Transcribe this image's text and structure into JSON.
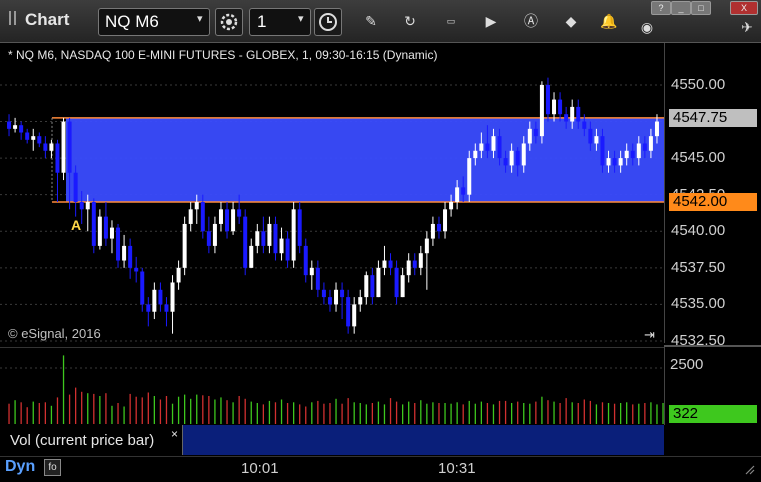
{
  "toolbar": {
    "title": "Chart",
    "symbol": "NQ M6",
    "interval": "1",
    "tools": [
      "settings-icon",
      "clock-icon",
      "pencil-icon",
      "refresh-icon",
      "get-icon",
      "play-icon",
      "alert-icon",
      "tag-icon",
      "bell-icon",
      "globe-icon",
      "bird-icon"
    ],
    "window_buttons": [
      "?",
      "_",
      "□",
      "X"
    ]
  },
  "chart": {
    "symbol_line": "* NQ M6, NASDAQ 100 E-MINI FUTURES - GLOBEX, 1, 09:30-16:15 (Dynamic)",
    "copyright": "© eSignal, 2016",
    "marker": "A",
    "price_ticks": [
      "4550.00",
      "4547.50",
      "4545.00",
      "4542.50",
      "4540.00",
      "4537.50",
      "4535.00",
      "4532.50"
    ],
    "price_tag_high": "4547.75",
    "price_tag_low": "4542.00",
    "volume_ticks": [
      "2500"
    ],
    "volume_tag": "322",
    "volume_tab_label": "Vol (current price bar)",
    "volume_tab_close": "×",
    "time_labels": [
      "10:01",
      "10:31"
    ],
    "dyn_label": "Dyn",
    "colors": {
      "up": "#ffffff",
      "down": "#1a1aff",
      "band": "#3a4cff",
      "band_line": "#ff8a3a",
      "tag_low": "#ff8a1a",
      "tag_high": "#bfbfbf",
      "vol_tag": "#3ec81e"
    }
  },
  "chart_data": {
    "type": "candlestick",
    "y_range": [
      4532.5,
      4551.5
    ],
    "band": {
      "low": 4542.0,
      "high": 4547.75
    },
    "candles": [
      [
        4547.5,
        4547.0,
        4548.0,
        4546.5
      ],
      [
        4547.0,
        4547.25,
        4547.75,
        4546.75
      ],
      [
        4547.25,
        4546.75,
        4547.5,
        4546.25
      ],
      [
        4546.75,
        4546.25,
        4547.0,
        4546.0
      ],
      [
        4546.25,
        4546.5,
        4547.0,
        4545.5
      ],
      [
        4546.5,
        4546.0,
        4546.75,
        4545.75
      ],
      [
        4546.0,
        4545.5,
        4546.5,
        4545.0
      ],
      [
        4545.5,
        4546.0,
        4546.25,
        4545.0
      ],
      [
        4546.0,
        4544.0,
        4546.25,
        4542.0
      ],
      [
        4544.0,
        4547.5,
        4547.75,
        4543.5
      ],
      [
        4547.5,
        4544.0,
        4547.75,
        4541.5
      ],
      [
        4544.0,
        4542.0,
        4544.5,
        4541.0
      ],
      [
        4542.0,
        4541.5,
        4542.75,
        4540.5
      ],
      [
        4541.5,
        4542.0,
        4542.5,
        4540.0
      ],
      [
        4542.0,
        4539.0,
        4542.25,
        4538.5
      ],
      [
        4539.0,
        4541.0,
        4541.5,
        4538.75
      ],
      [
        4541.0,
        4539.5,
        4542.0,
        4539.0
      ],
      [
        4539.5,
        4540.25,
        4540.75,
        4538.5
      ],
      [
        4540.25,
        4538.0,
        4540.5,
        4537.5
      ],
      [
        4538.0,
        4539.0,
        4539.75,
        4537.5
      ],
      [
        4539.0,
        4537.5,
        4539.5,
        4536.75
      ],
      [
        4537.5,
        4537.25,
        4538.25,
        4536.5
      ],
      [
        4537.25,
        4535.0,
        4537.5,
        4534.5
      ],
      [
        4535.0,
        4534.5,
        4535.5,
        4533.5
      ],
      [
        4534.5,
        4536.0,
        4536.5,
        4534.0
      ],
      [
        4536.0,
        4535.0,
        4536.5,
        4534.5
      ],
      [
        4535.0,
        4534.5,
        4535.5,
        4533.5
      ],
      [
        4534.5,
        4536.5,
        4537.0,
        4533.0
      ],
      [
        4536.5,
        4537.5,
        4538.0,
        4536.0
      ],
      [
        4537.5,
        4540.5,
        4541.0,
        4537.0
      ],
      [
        4540.5,
        4541.5,
        4542.0,
        4540.0
      ],
      [
        4541.5,
        4542.0,
        4542.5,
        4540.5
      ],
      [
        4542.0,
        4540.0,
        4542.5,
        4539.5
      ],
      [
        4540.0,
        4539.0,
        4541.0,
        4538.5
      ],
      [
        4539.0,
        4540.5,
        4541.0,
        4538.5
      ],
      [
        4540.5,
        4541.5,
        4542.0,
        4540.0
      ],
      [
        4541.5,
        4540.0,
        4542.0,
        4539.5
      ],
      [
        4540.0,
        4541.5,
        4542.0,
        4539.75
      ],
      [
        4541.5,
        4541.0,
        4542.5,
        4540.5
      ],
      [
        4541.0,
        4537.5,
        4541.5,
        4537.0
      ],
      [
        4537.5,
        4539.0,
        4539.5,
        4537.5
      ],
      [
        4539.0,
        4540.0,
        4540.5,
        4538.5
      ],
      [
        4540.0,
        4539.0,
        4541.0,
        4538.5
      ],
      [
        4539.0,
        4540.5,
        4541.0,
        4538.5
      ],
      [
        4540.5,
        4538.5,
        4541.0,
        4538.0
      ],
      [
        4538.5,
        4539.5,
        4540.25,
        4538.0
      ],
      [
        4539.5,
        4538.0,
        4540.0,
        4537.5
      ],
      [
        4538.0,
        4541.5,
        4542.0,
        4537.5
      ],
      [
        4541.5,
        4539.0,
        4542.0,
        4538.5
      ],
      [
        4539.0,
        4537.0,
        4539.5,
        4536.5
      ],
      [
        4537.0,
        4537.5,
        4538.0,
        4536.0
      ],
      [
        4537.5,
        4536.0,
        4538.0,
        4535.5
      ],
      [
        4536.0,
        4535.5,
        4536.5,
        4535.0
      ],
      [
        4535.5,
        4535.0,
        4536.0,
        4534.5
      ],
      [
        4535.0,
        4536.0,
        4536.5,
        4534.5
      ],
      [
        4536.0,
        4535.5,
        4536.5,
        4534.0
      ],
      [
        4535.5,
        4533.5,
        4536.0,
        4533.0
      ],
      [
        4533.5,
        4535.0,
        4535.5,
        4533.0
      ],
      [
        4535.0,
        4535.5,
        4536.0,
        4534.5
      ],
      [
        4535.5,
        4537.0,
        4537.25,
        4535.0
      ],
      [
        4537.0,
        4535.5,
        4537.5,
        4535.0
      ],
      [
        4535.5,
        4537.5,
        4538.0,
        4535.5
      ],
      [
        4537.5,
        4538.0,
        4539.0,
        4537.0
      ],
      [
        4538.0,
        4537.5,
        4538.5,
        4537.0
      ],
      [
        4537.5,
        4535.5,
        4538.0,
        4535.0
      ],
      [
        4535.5,
        4537.0,
        4537.5,
        4535.5
      ],
      [
        4537.0,
        4538.0,
        4538.5,
        4536.5
      ],
      [
        4538.0,
        4537.5,
        4538.5,
        4537.0
      ],
      [
        4537.5,
        4538.5,
        4539.0,
        4537.0
      ],
      [
        4538.5,
        4539.5,
        4540.0,
        4536.0
      ],
      [
        4539.5,
        4540.5,
        4541.0,
        4539.0
      ],
      [
        4540.5,
        4540.0,
        4541.0,
        4539.5
      ],
      [
        4540.0,
        4541.5,
        4542.0,
        4539.5
      ],
      [
        4541.5,
        4542.0,
        4542.5,
        4541.0
      ],
      [
        4542.0,
        4543.0,
        4543.5,
        4541.5
      ],
      [
        4543.0,
        4542.5,
        4543.75,
        4542.0
      ],
      [
        4542.5,
        4545.0,
        4545.5,
        4542.0
      ],
      [
        4545.0,
        4545.5,
        4546.0,
        4544.5
      ],
      [
        4545.5,
        4546.0,
        4546.75,
        4545.0
      ],
      [
        4546.0,
        4545.5,
        4547.25,
        4545.0
      ],
      [
        4545.5,
        4546.5,
        4547.0,
        4545.0
      ],
      [
        4546.5,
        4545.0,
        4547.0,
        4544.5
      ],
      [
        4545.0,
        4544.5,
        4545.5,
        4544.0
      ],
      [
        4544.5,
        4545.5,
        4546.0,
        4544.0
      ],
      [
        4545.5,
        4544.5,
        4545.75,
        4543.75
      ],
      [
        4544.5,
        4546.0,
        4546.5,
        4544.0
      ],
      [
        4546.0,
        4547.0,
        4547.5,
        4545.5
      ],
      [
        4547.0,
        4546.5,
        4547.5,
        4546.0
      ],
      [
        4546.5,
        4550.0,
        4550.25,
        4546.0
      ],
      [
        4550.0,
        4548.0,
        4550.5,
        4547.5
      ],
      [
        4548.0,
        4549.0,
        4549.5,
        4547.5
      ],
      [
        4549.0,
        4548.0,
        4549.5,
        4547.5
      ],
      [
        4548.0,
        4547.5,
        4548.5,
        4547.0
      ],
      [
        4547.5,
        4548.5,
        4549.0,
        4547.0
      ],
      [
        4548.5,
        4547.5,
        4549.0,
        4547.0
      ],
      [
        4547.5,
        4547.0,
        4548.0,
        4546.5
      ],
      [
        4547.0,
        4546.0,
        4547.5,
        4545.5
      ],
      [
        4546.0,
        4546.5,
        4547.0,
        4545.5
      ],
      [
        4546.5,
        4544.5,
        4547.0,
        4544.0
      ],
      [
        4544.5,
        4545.0,
        4545.5,
        4544.0
      ],
      [
        4545.0,
        4544.5,
        4545.5,
        4544.0
      ],
      [
        4544.5,
        4545.0,
        4545.5,
        4544.0
      ],
      [
        4545.0,
        4545.5,
        4546.0,
        4544.5
      ],
      [
        4545.5,
        4545.0,
        4546.0,
        4544.5
      ],
      [
        4545.0,
        4546.0,
        4546.5,
        4544.5
      ],
      [
        4546.0,
        4545.5,
        4546.5,
        4545.0
      ],
      [
        4545.5,
        4546.5,
        4547.0,
        4545.0
      ],
      [
        4546.5,
        4547.5,
        4548.0,
        4546.0
      ]
    ],
    "volumes": [
      290,
      340,
      310,
      240,
      320,
      300,
      310,
      260,
      380,
      980,
      420,
      520,
      460,
      440,
      430,
      400,
      440,
      260,
      300,
      250,
      430,
      390,
      380,
      450,
      400,
      350,
      400,
      290,
      390,
      420,
      360,
      420,
      410,
      400,
      350,
      380,
      340,
      310,
      400,
      360,
      320,
      300,
      280,
      330,
      310,
      350,
      300,
      310,
      280,
      250,
      310,
      330,
      290,
      300,
      360,
      290,
      370,
      310,
      300,
      280,
      300,
      320,
      280,
      370,
      320,
      280,
      320,
      300,
      340,
      290,
      310,
      300,
      300,
      290,
      310,
      280,
      330,
      290,
      320,
      300,
      280,
      330,
      330,
      300,
      320,
      300,
      290,
      320,
      390,
      340,
      320,
      300,
      370,
      310,
      300,
      350,
      330,
      280,
      310,
      300,
      290,
      300,
      310,
      280,
      290,
      300,
      310,
      280,
      300,
      270,
      322
    ]
  }
}
